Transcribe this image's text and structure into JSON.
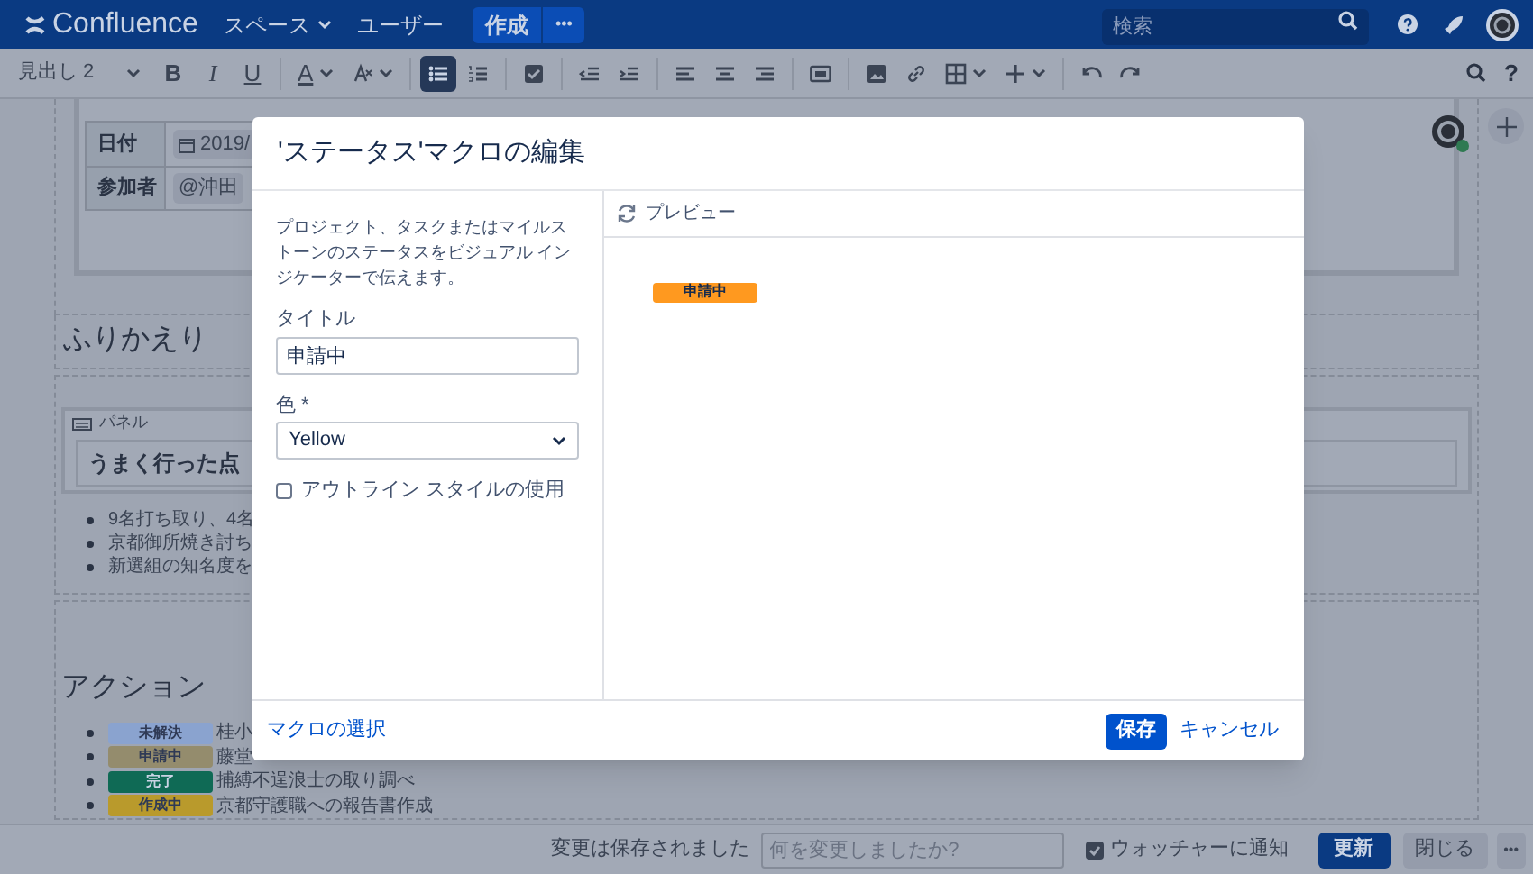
{
  "nav": {
    "logo": "Confluence",
    "items": [
      {
        "label": "スペース",
        "dropdown": true
      },
      {
        "label": "ユーザー",
        "dropdown": false
      }
    ],
    "create": "作成",
    "more": "•••",
    "search": {
      "placeholder": "検索"
    }
  },
  "toolbar": {
    "style": "見出し 2",
    "tools": [
      {
        "kind": "bold",
        "label": "B",
        "selected": false
      },
      {
        "kind": "italic",
        "label": "I",
        "selected": false
      },
      {
        "kind": "underline",
        "label": "U",
        "selected": false
      },
      {
        "kind": "color",
        "label": "A",
        "selected": false
      },
      {
        "kind": "clear",
        "selected": false
      },
      {
        "kind": "bullets",
        "selected": true
      },
      {
        "kind": "numbers",
        "selected": false
      },
      {
        "kind": "task",
        "selected": false
      },
      {
        "kind": "outdent",
        "selected": false
      },
      {
        "kind": "indent",
        "selected": false
      },
      {
        "kind": "align-left",
        "selected": false
      },
      {
        "kind": "align-center",
        "selected": false
      },
      {
        "kind": "align-right",
        "selected": false
      },
      {
        "kind": "layout",
        "selected": false
      },
      {
        "kind": "image",
        "selected": false
      },
      {
        "kind": "link",
        "selected": false
      },
      {
        "kind": "table",
        "selected": false
      },
      {
        "kind": "insert",
        "selected": false
      },
      {
        "kind": "undo",
        "selected": false
      },
      {
        "kind": "redo",
        "selected": false
      }
    ],
    "help": "?"
  },
  "page": {
    "details": [
      {
        "label": "日付",
        "value": "2019/",
        "kind": "date"
      },
      {
        "label": "参加者",
        "value": "@沖田",
        "kind": "mention"
      }
    ],
    "retro_heading": "ふりかえり",
    "panel": {
      "label": "パネル",
      "title": "うまく行った点"
    },
    "bullets": [
      "9名打ち取り、4名",
      "京都御所焼き討ち",
      "新選組の知名度を"
    ],
    "action_heading": "アクション",
    "actions": [
      {
        "status": "未解決",
        "color": "#8aa3cf",
        "text": "桂小"
      },
      {
        "status": "申請中",
        "color": "#948c6d",
        "text": "藤堂"
      },
      {
        "status": "完了",
        "color": "#0f6a55",
        "text": "捕縛不逞浪士の取り調べ"
      },
      {
        "status": "作成中",
        "color": "#b99a2c",
        "text": "京都守護職への報告書作成"
      }
    ]
  },
  "dialog": {
    "title": "'ステータス'マクロの編集",
    "description": "プロジェクト、タスクまたはマイルストーンのステータスをビジュアル インジケーターで伝えます。",
    "title_field": {
      "label": "タイトル",
      "value": "申請中"
    },
    "color_field": {
      "label": "色 *",
      "value": "Yellow"
    },
    "outline": {
      "label": "アウトライン スタイルの使用",
      "checked": false
    },
    "preview_label": "プレビュー",
    "preview_status": {
      "text": "申請中",
      "color": "#ff991f"
    },
    "select_macro": "マクロの選択",
    "save": "保存",
    "cancel": "キャンセル"
  },
  "bottom_bar": {
    "saved": "変更は保存されました",
    "comment": {
      "placeholder": "何を変更しましたか?"
    },
    "notify": {
      "label": "ウォッチャーに通知",
      "checked": true
    },
    "update": "更新",
    "close": "閉じる",
    "more": "•••"
  }
}
